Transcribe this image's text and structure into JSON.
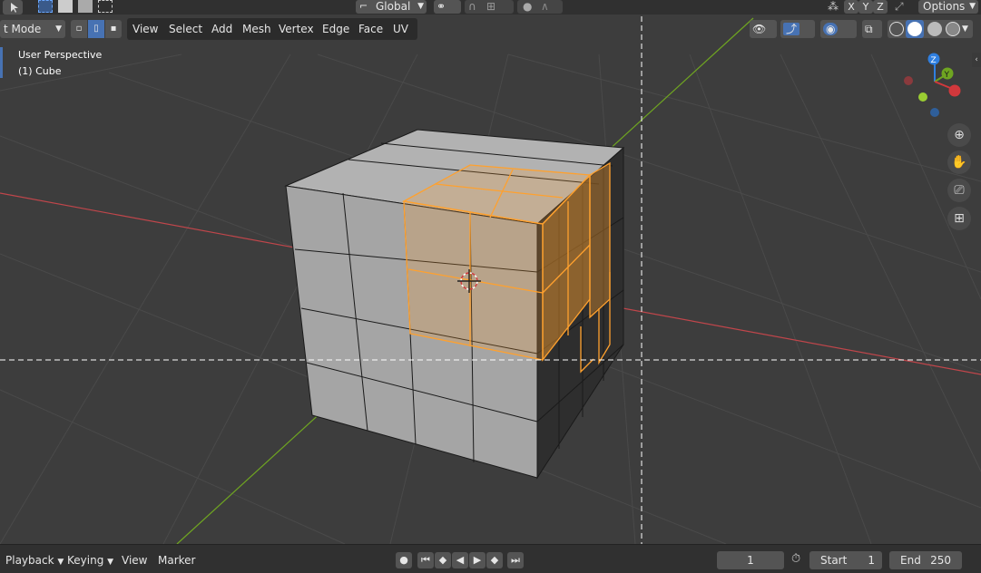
{
  "topbar": {
    "orientation": "Global",
    "axis_x": "X",
    "axis_y": "Y",
    "axis_z": "Z",
    "options": "Options"
  },
  "header": {
    "mode": "t Mode",
    "menus": [
      "View",
      "Select",
      "Add",
      "Mesh",
      "Vertex",
      "Edge",
      "Face",
      "UV"
    ]
  },
  "viewport": {
    "perspective": "User Perspective",
    "object": "(1) Cube"
  },
  "gizmo": {
    "z": "Z",
    "y": "Y"
  },
  "timeline": {
    "playback": "Playback",
    "keying": "Keying",
    "view": "View",
    "marker": "Marker",
    "current_frame": "1",
    "start_label": "Start",
    "start_value": "1",
    "end_label": "End",
    "end_value": "250"
  },
  "colors": {
    "background": "#3d3d3d",
    "selection": "#ffa12e",
    "x_axis": "#c0464b",
    "y_axis": "#6fa521",
    "cube_face": "#a3a3a3"
  }
}
